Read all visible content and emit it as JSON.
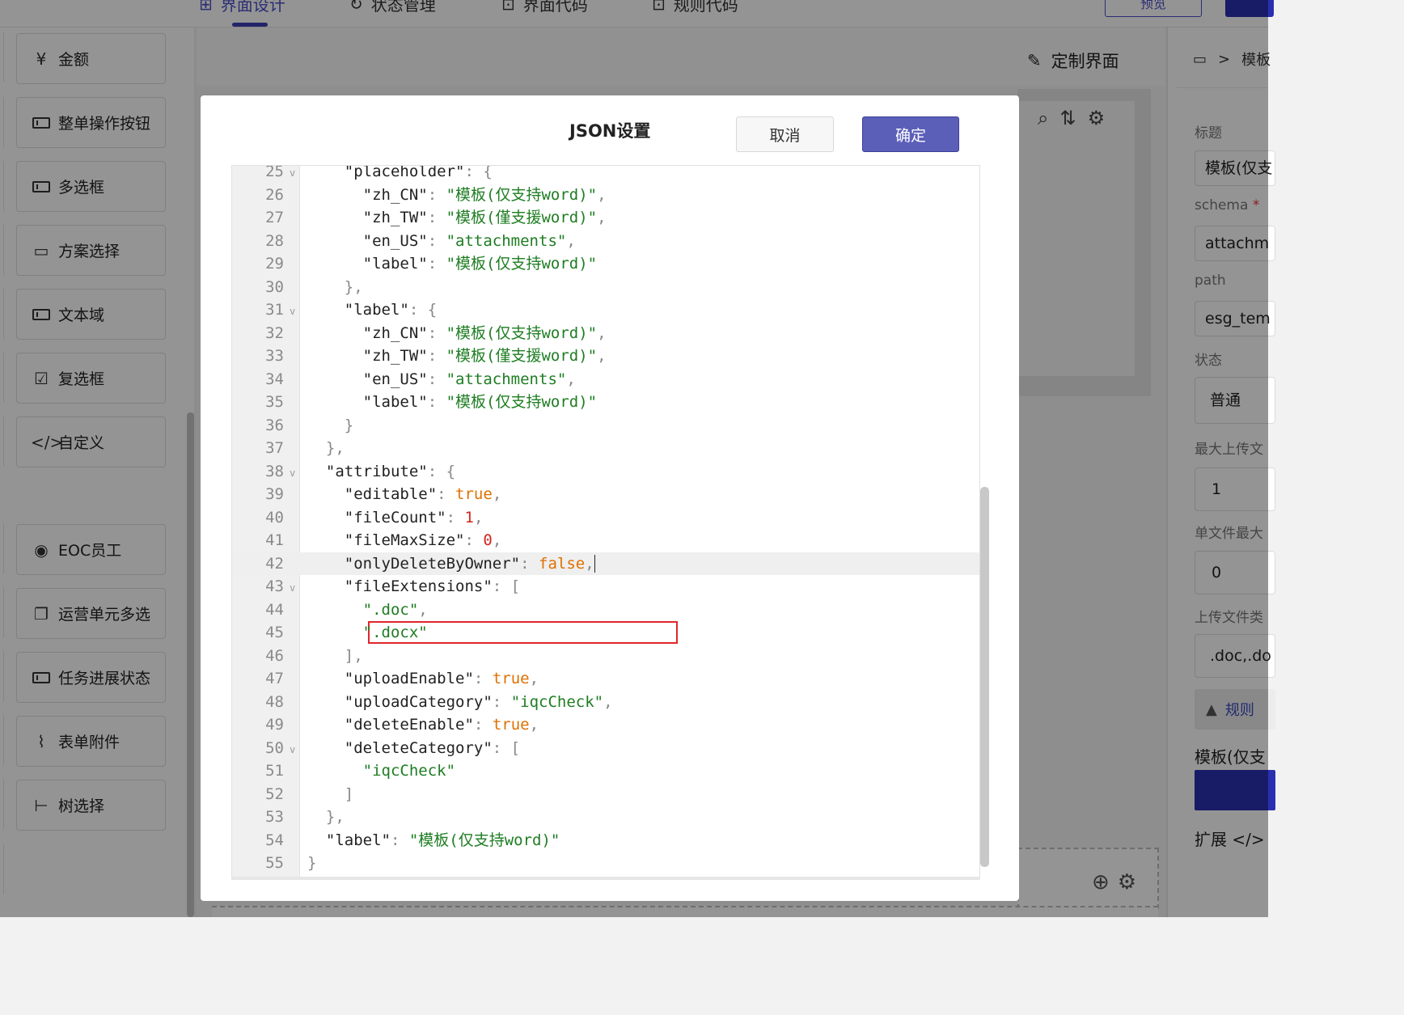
{
  "topbar": {
    "tabs": [
      {
        "label": "界面设计",
        "icon": "grid-icon"
      },
      {
        "label": "状态管理",
        "icon": "refresh-icon"
      },
      {
        "label": "界面代码",
        "icon": "code-window-icon"
      },
      {
        "label": "规则代码",
        "icon": "code-window-icon"
      }
    ],
    "preview_label": "预览"
  },
  "sidebar": {
    "items": [
      {
        "label": "金额",
        "icon": "yuan-circle-icon"
      },
      {
        "label": "整单操作按钮",
        "icon": "input-box-icon"
      },
      {
        "label": "多选框",
        "icon": "input-box-icon"
      },
      {
        "label": "方案选择",
        "icon": "select-box-icon"
      },
      {
        "label": "文本域",
        "icon": "input-box-icon"
      },
      {
        "label": "复选框",
        "icon": "checkbox-icon"
      },
      {
        "label": "自定义",
        "icon": "code-brackets-icon"
      },
      {
        "label": "EOC员工",
        "icon": "user-circle-icon"
      },
      {
        "label": "运营单元多选",
        "icon": "document-stack-icon"
      },
      {
        "label": "任务进展状态",
        "icon": "input-box-icon"
      },
      {
        "label": "表单附件",
        "icon": "paperclip-icon"
      },
      {
        "label": "树选择",
        "icon": "tree-icon"
      }
    ]
  },
  "canvas": {
    "custom_ui_label": "定制界面"
  },
  "properties": {
    "breadcrumb": ">",
    "breadcrumb_text": "模板",
    "title_label": "标题",
    "title_value": "模板(仅支",
    "schema_label": "schema",
    "schema_required": "*",
    "schema_value": "attachm",
    "path_label": "path",
    "path_value": "esg_tem",
    "status_label": "状态",
    "status_value": "普通",
    "max_upload_label": "最大上传文",
    "max_upload_value": "1",
    "single_file_label": "单文件最大",
    "single_file_value": "0",
    "upload_type_label": "上传文件类",
    "upload_type_value": ".doc,.do",
    "rule_label": "规则",
    "preview_title": "模板(仅支",
    "extend_label": "扩展 </>"
  },
  "modal": {
    "title": "JSON设置",
    "cancel_label": "取消",
    "ok_label": "确定",
    "active_line": 42,
    "lines": [
      {
        "n": "25",
        "fold": true,
        "indent": 4,
        "tokens": [
          [
            "k",
            "\"placeholder\""
          ],
          [
            "p",
            ": {"
          ]
        ]
      },
      {
        "n": "26",
        "fold": false,
        "indent": 6,
        "tokens": [
          [
            "k",
            "\"zh_CN\""
          ],
          [
            "p",
            ": "
          ],
          [
            "s",
            "\"模板(仅支持word)\""
          ],
          [
            "p",
            ","
          ]
        ]
      },
      {
        "n": "27",
        "fold": false,
        "indent": 6,
        "tokens": [
          [
            "k",
            "\"zh_TW\""
          ],
          [
            "p",
            ": "
          ],
          [
            "s",
            "\"模板(僅支援word)\""
          ],
          [
            "p",
            ","
          ]
        ]
      },
      {
        "n": "28",
        "fold": false,
        "indent": 6,
        "tokens": [
          [
            "k",
            "\"en_US\""
          ],
          [
            "p",
            ": "
          ],
          [
            "s",
            "\"attachments\""
          ],
          [
            "p",
            ","
          ]
        ]
      },
      {
        "n": "29",
        "fold": false,
        "indent": 6,
        "tokens": [
          [
            "k",
            "\"label\""
          ],
          [
            "p",
            ": "
          ],
          [
            "s",
            "\"模板(仅支持word)\""
          ]
        ]
      },
      {
        "n": "30",
        "fold": false,
        "indent": 4,
        "tokens": [
          [
            "p",
            "},"
          ]
        ]
      },
      {
        "n": "31",
        "fold": true,
        "indent": 4,
        "tokens": [
          [
            "k",
            "\"label\""
          ],
          [
            "p",
            ": {"
          ]
        ]
      },
      {
        "n": "32",
        "fold": false,
        "indent": 6,
        "tokens": [
          [
            "k",
            "\"zh_CN\""
          ],
          [
            "p",
            ": "
          ],
          [
            "s",
            "\"模板(仅支持word)\""
          ],
          [
            "p",
            ","
          ]
        ]
      },
      {
        "n": "33",
        "fold": false,
        "indent": 6,
        "tokens": [
          [
            "k",
            "\"zh_TW\""
          ],
          [
            "p",
            ": "
          ],
          [
            "s",
            "\"模板(僅支援word)\""
          ],
          [
            "p",
            ","
          ]
        ]
      },
      {
        "n": "34",
        "fold": false,
        "indent": 6,
        "tokens": [
          [
            "k",
            "\"en_US\""
          ],
          [
            "p",
            ": "
          ],
          [
            "s",
            "\"attachments\""
          ],
          [
            "p",
            ","
          ]
        ]
      },
      {
        "n": "35",
        "fold": false,
        "indent": 6,
        "tokens": [
          [
            "k",
            "\"label\""
          ],
          [
            "p",
            ": "
          ],
          [
            "s",
            "\"模板(仅支持word)\""
          ]
        ]
      },
      {
        "n": "36",
        "fold": false,
        "indent": 4,
        "tokens": [
          [
            "p",
            "}"
          ]
        ]
      },
      {
        "n": "37",
        "fold": false,
        "indent": 2,
        "tokens": [
          [
            "p",
            "},"
          ]
        ]
      },
      {
        "n": "38",
        "fold": true,
        "indent": 2,
        "tokens": [
          [
            "k",
            "\"attribute\""
          ],
          [
            "p",
            ": {"
          ]
        ]
      },
      {
        "n": "39",
        "fold": false,
        "indent": 4,
        "tokens": [
          [
            "k",
            "\"editable\""
          ],
          [
            "p",
            ": "
          ],
          [
            "b",
            "true"
          ],
          [
            "p",
            ","
          ]
        ]
      },
      {
        "n": "40",
        "fold": false,
        "indent": 4,
        "tokens": [
          [
            "k",
            "\"fileCount\""
          ],
          [
            "p",
            ": "
          ],
          [
            "n",
            "1"
          ],
          [
            "p",
            ","
          ]
        ]
      },
      {
        "n": "41",
        "fold": false,
        "indent": 4,
        "tokens": [
          [
            "k",
            "\"fileMaxSize\""
          ],
          [
            "p",
            ": "
          ],
          [
            "n",
            "0"
          ],
          [
            "p",
            ","
          ]
        ]
      },
      {
        "n": "42",
        "fold": false,
        "indent": 4,
        "tokens": [
          [
            "k",
            "\"onlyDeleteByOwner\""
          ],
          [
            "p",
            ": "
          ],
          [
            "b",
            "false"
          ],
          [
            "p",
            ","
          ]
        ]
      },
      {
        "n": "43",
        "fold": true,
        "indent": 4,
        "tokens": [
          [
            "k",
            "\"fileExtensions\""
          ],
          [
            "p",
            ": ["
          ]
        ]
      },
      {
        "n": "44",
        "fold": false,
        "indent": 6,
        "tokens": [
          [
            "s",
            "\".doc\""
          ],
          [
            "p",
            ","
          ]
        ]
      },
      {
        "n": "45",
        "fold": false,
        "indent": 6,
        "tokens": [
          [
            "s",
            "\".docx\""
          ]
        ]
      },
      {
        "n": "46",
        "fold": false,
        "indent": 4,
        "tokens": [
          [
            "p",
            "],"
          ]
        ]
      },
      {
        "n": "47",
        "fold": false,
        "indent": 4,
        "tokens": [
          [
            "k",
            "\"uploadEnable\""
          ],
          [
            "p",
            ": "
          ],
          [
            "b",
            "true"
          ],
          [
            "p",
            ","
          ]
        ]
      },
      {
        "n": "48",
        "fold": false,
        "indent": 4,
        "tokens": [
          [
            "k",
            "\"uploadCategory\""
          ],
          [
            "p",
            ": "
          ],
          [
            "s",
            "\"iqcCheck\""
          ],
          [
            "p",
            ","
          ]
        ]
      },
      {
        "n": "49",
        "fold": false,
        "indent": 4,
        "tokens": [
          [
            "k",
            "\"deleteEnable\""
          ],
          [
            "p",
            ": "
          ],
          [
            "b",
            "true"
          ],
          [
            "p",
            ","
          ]
        ]
      },
      {
        "n": "50",
        "fold": true,
        "indent": 4,
        "tokens": [
          [
            "k",
            "\"deleteCategory\""
          ],
          [
            "p",
            ": ["
          ]
        ]
      },
      {
        "n": "51",
        "fold": false,
        "indent": 6,
        "tokens": [
          [
            "s",
            "\"iqcCheck\""
          ]
        ]
      },
      {
        "n": "52",
        "fold": false,
        "indent": 4,
        "tokens": [
          [
            "p",
            "]"
          ]
        ]
      },
      {
        "n": "53",
        "fold": false,
        "indent": 2,
        "tokens": [
          [
            "p",
            "},"
          ]
        ]
      },
      {
        "n": "54",
        "fold": false,
        "indent": 2,
        "tokens": [
          [
            "k",
            "\"label\""
          ],
          [
            "p",
            ": "
          ],
          [
            "s",
            "\"模板(仅支持word)\""
          ]
        ]
      },
      {
        "n": "55",
        "fold": false,
        "indent": 0,
        "tokens": [
          [
            "p",
            "}"
          ]
        ]
      }
    ]
  },
  "colors": {
    "primary": "#5b5fb8",
    "string": "#1e7d22",
    "boolean": "#e07000",
    "number": "#d4261c",
    "highlight": "#e0272a"
  }
}
